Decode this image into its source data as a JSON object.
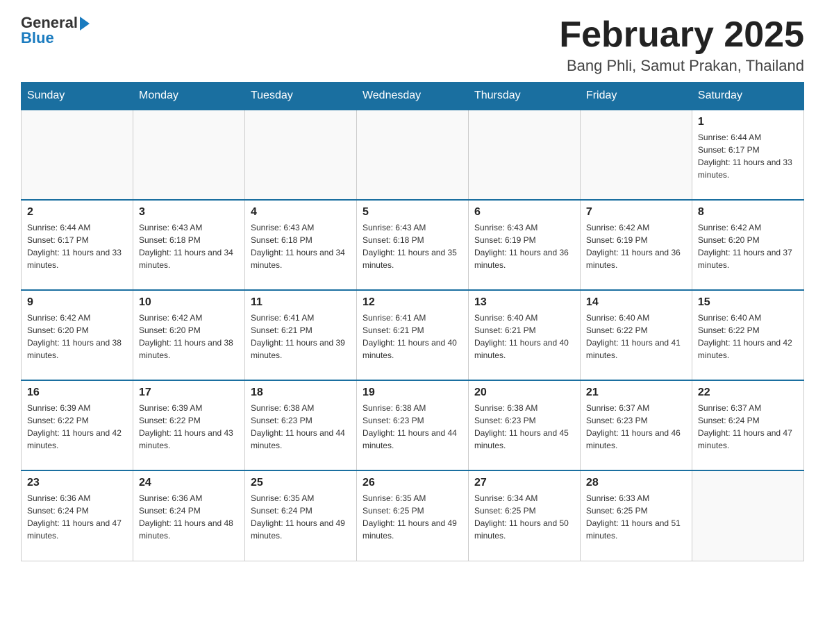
{
  "header": {
    "logo_general": "General",
    "logo_blue": "Blue",
    "month_title": "February 2025",
    "location": "Bang Phli, Samut Prakan, Thailand"
  },
  "weekdays": [
    "Sunday",
    "Monday",
    "Tuesday",
    "Wednesday",
    "Thursday",
    "Friday",
    "Saturday"
  ],
  "weeks": [
    [
      {
        "day": "",
        "empty": true
      },
      {
        "day": "",
        "empty": true
      },
      {
        "day": "",
        "empty": true
      },
      {
        "day": "",
        "empty": true
      },
      {
        "day": "",
        "empty": true
      },
      {
        "day": "",
        "empty": true
      },
      {
        "day": "1",
        "sunrise": "6:44 AM",
        "sunset": "6:17 PM",
        "daylight": "11 hours and 33 minutes."
      }
    ],
    [
      {
        "day": "2",
        "sunrise": "6:44 AM",
        "sunset": "6:17 PM",
        "daylight": "11 hours and 33 minutes."
      },
      {
        "day": "3",
        "sunrise": "6:43 AM",
        "sunset": "6:18 PM",
        "daylight": "11 hours and 34 minutes."
      },
      {
        "day": "4",
        "sunrise": "6:43 AM",
        "sunset": "6:18 PM",
        "daylight": "11 hours and 34 minutes."
      },
      {
        "day": "5",
        "sunrise": "6:43 AM",
        "sunset": "6:18 PM",
        "daylight": "11 hours and 35 minutes."
      },
      {
        "day": "6",
        "sunrise": "6:43 AM",
        "sunset": "6:19 PM",
        "daylight": "11 hours and 36 minutes."
      },
      {
        "day": "7",
        "sunrise": "6:42 AM",
        "sunset": "6:19 PM",
        "daylight": "11 hours and 36 minutes."
      },
      {
        "day": "8",
        "sunrise": "6:42 AM",
        "sunset": "6:20 PM",
        "daylight": "11 hours and 37 minutes."
      }
    ],
    [
      {
        "day": "9",
        "sunrise": "6:42 AM",
        "sunset": "6:20 PM",
        "daylight": "11 hours and 38 minutes."
      },
      {
        "day": "10",
        "sunrise": "6:42 AM",
        "sunset": "6:20 PM",
        "daylight": "11 hours and 38 minutes."
      },
      {
        "day": "11",
        "sunrise": "6:41 AM",
        "sunset": "6:21 PM",
        "daylight": "11 hours and 39 minutes."
      },
      {
        "day": "12",
        "sunrise": "6:41 AM",
        "sunset": "6:21 PM",
        "daylight": "11 hours and 40 minutes."
      },
      {
        "day": "13",
        "sunrise": "6:40 AM",
        "sunset": "6:21 PM",
        "daylight": "11 hours and 40 minutes."
      },
      {
        "day": "14",
        "sunrise": "6:40 AM",
        "sunset": "6:22 PM",
        "daylight": "11 hours and 41 minutes."
      },
      {
        "day": "15",
        "sunrise": "6:40 AM",
        "sunset": "6:22 PM",
        "daylight": "11 hours and 42 minutes."
      }
    ],
    [
      {
        "day": "16",
        "sunrise": "6:39 AM",
        "sunset": "6:22 PM",
        "daylight": "11 hours and 42 minutes."
      },
      {
        "day": "17",
        "sunrise": "6:39 AM",
        "sunset": "6:22 PM",
        "daylight": "11 hours and 43 minutes."
      },
      {
        "day": "18",
        "sunrise": "6:38 AM",
        "sunset": "6:23 PM",
        "daylight": "11 hours and 44 minutes."
      },
      {
        "day": "19",
        "sunrise": "6:38 AM",
        "sunset": "6:23 PM",
        "daylight": "11 hours and 44 minutes."
      },
      {
        "day": "20",
        "sunrise": "6:38 AM",
        "sunset": "6:23 PM",
        "daylight": "11 hours and 45 minutes."
      },
      {
        "day": "21",
        "sunrise": "6:37 AM",
        "sunset": "6:23 PM",
        "daylight": "11 hours and 46 minutes."
      },
      {
        "day": "22",
        "sunrise": "6:37 AM",
        "sunset": "6:24 PM",
        "daylight": "11 hours and 47 minutes."
      }
    ],
    [
      {
        "day": "23",
        "sunrise": "6:36 AM",
        "sunset": "6:24 PM",
        "daylight": "11 hours and 47 minutes."
      },
      {
        "day": "24",
        "sunrise": "6:36 AM",
        "sunset": "6:24 PM",
        "daylight": "11 hours and 48 minutes."
      },
      {
        "day": "25",
        "sunrise": "6:35 AM",
        "sunset": "6:24 PM",
        "daylight": "11 hours and 49 minutes."
      },
      {
        "day": "26",
        "sunrise": "6:35 AM",
        "sunset": "6:25 PM",
        "daylight": "11 hours and 49 minutes."
      },
      {
        "day": "27",
        "sunrise": "6:34 AM",
        "sunset": "6:25 PM",
        "daylight": "11 hours and 50 minutes."
      },
      {
        "day": "28",
        "sunrise": "6:33 AM",
        "sunset": "6:25 PM",
        "daylight": "11 hours and 51 minutes."
      },
      {
        "day": "",
        "empty": true
      }
    ]
  ],
  "labels": {
    "sunrise": "Sunrise:",
    "sunset": "Sunset:",
    "daylight": "Daylight:"
  }
}
